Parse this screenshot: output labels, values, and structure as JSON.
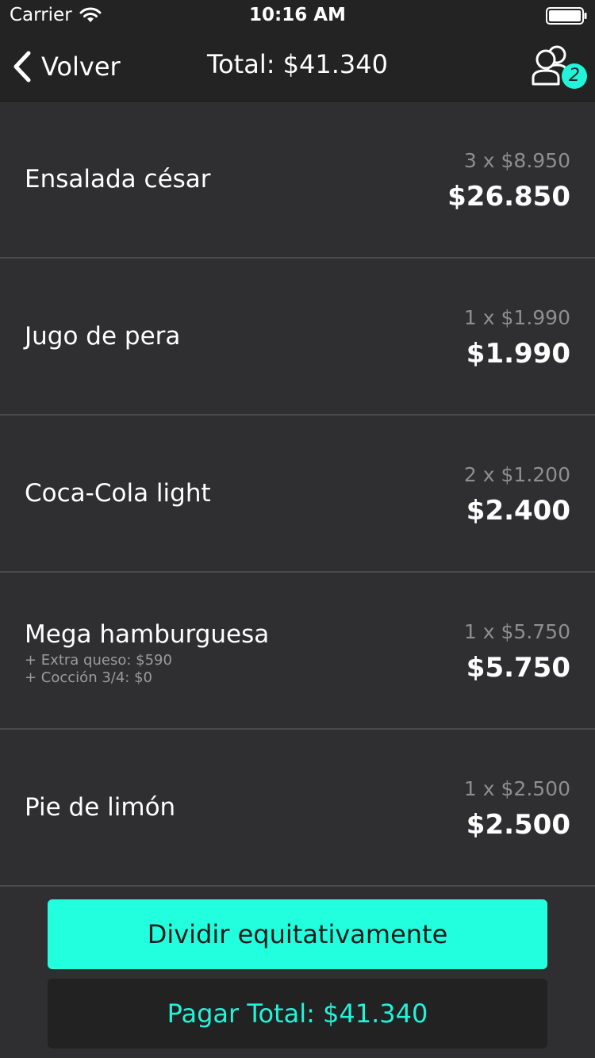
{
  "status_bar": {
    "carrier": "Carrier",
    "time": "10:16 AM",
    "wifi_icon": "wifi-icon",
    "battery_icon": "battery-icon"
  },
  "nav": {
    "back_label": "Volver",
    "back_icon": "chevron-left-icon",
    "title": "Total: $41.340",
    "people_icon": "people-icon",
    "people_count": "2"
  },
  "items": [
    {
      "name": "Ensalada césar",
      "modifiers": [],
      "unit": "3 x $8.950",
      "total": "$26.850"
    },
    {
      "name": "Jugo de pera",
      "modifiers": [],
      "unit": "1 x $1.990",
      "total": "$1.990"
    },
    {
      "name": "Coca-Cola light",
      "modifiers": [],
      "unit": "2 x $1.200",
      "total": "$2.400"
    },
    {
      "name": "Mega hamburguesa",
      "modifiers": [
        "+ Extra queso: $590",
        "+ Cocción 3/4: $0"
      ],
      "unit": "1 x $5.750",
      "total": "$5.750"
    },
    {
      "name": "Pie de limón",
      "modifiers": [],
      "unit": "1 x $2.500",
      "total": "$2.500"
    }
  ],
  "footer": {
    "split_label": "Dividir equitativamente",
    "pay_label": "Pagar Total: $41.340"
  },
  "colors": {
    "accent": "#22ffdf",
    "background": "#2f2f31",
    "bar": "#232323"
  }
}
